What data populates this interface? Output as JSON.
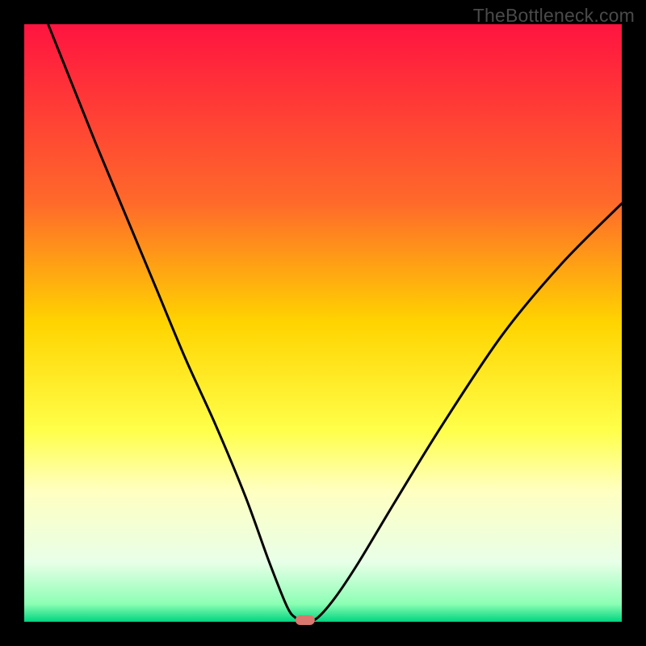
{
  "watermark": "TheBottleneck.com",
  "chart_data": {
    "type": "line",
    "title": "",
    "xlabel": "",
    "ylabel": "",
    "xlim": [
      0,
      100
    ],
    "ylim": [
      0,
      100
    ],
    "minimum_marker": {
      "x": 47,
      "y": 0
    },
    "gradient_stops": [
      {
        "offset": 0.0,
        "color": "#ff1440"
      },
      {
        "offset": 0.3,
        "color": "#ff6a2a"
      },
      {
        "offset": 0.5,
        "color": "#ffd400"
      },
      {
        "offset": 0.68,
        "color": "#ffff4a"
      },
      {
        "offset": 0.78,
        "color": "#ffffc0"
      },
      {
        "offset": 0.9,
        "color": "#e8ffe8"
      },
      {
        "offset": 0.97,
        "color": "#8cffb4"
      },
      {
        "offset": 1.0,
        "color": "#00d47f"
      }
    ],
    "curve_points": [
      {
        "x": 4.0,
        "y": 100.0
      },
      {
        "x": 8.0,
        "y": 90.0
      },
      {
        "x": 12.0,
        "y": 80.0
      },
      {
        "x": 17.0,
        "y": 68.0
      },
      {
        "x": 22.0,
        "y": 56.0
      },
      {
        "x": 27.0,
        "y": 44.0
      },
      {
        "x": 32.0,
        "y": 33.0
      },
      {
        "x": 37.0,
        "y": 21.0
      },
      {
        "x": 41.0,
        "y": 10.0
      },
      {
        "x": 44.0,
        "y": 2.5
      },
      {
        "x": 45.5,
        "y": 0.6
      },
      {
        "x": 47.0,
        "y": 0.0
      },
      {
        "x": 49.0,
        "y": 0.6
      },
      {
        "x": 52.0,
        "y": 4.0
      },
      {
        "x": 56.0,
        "y": 10.0
      },
      {
        "x": 62.0,
        "y": 20.0
      },
      {
        "x": 70.0,
        "y": 33.0
      },
      {
        "x": 80.0,
        "y": 48.0
      },
      {
        "x": 90.0,
        "y": 60.0
      },
      {
        "x": 100.0,
        "y": 70.0
      }
    ]
  }
}
